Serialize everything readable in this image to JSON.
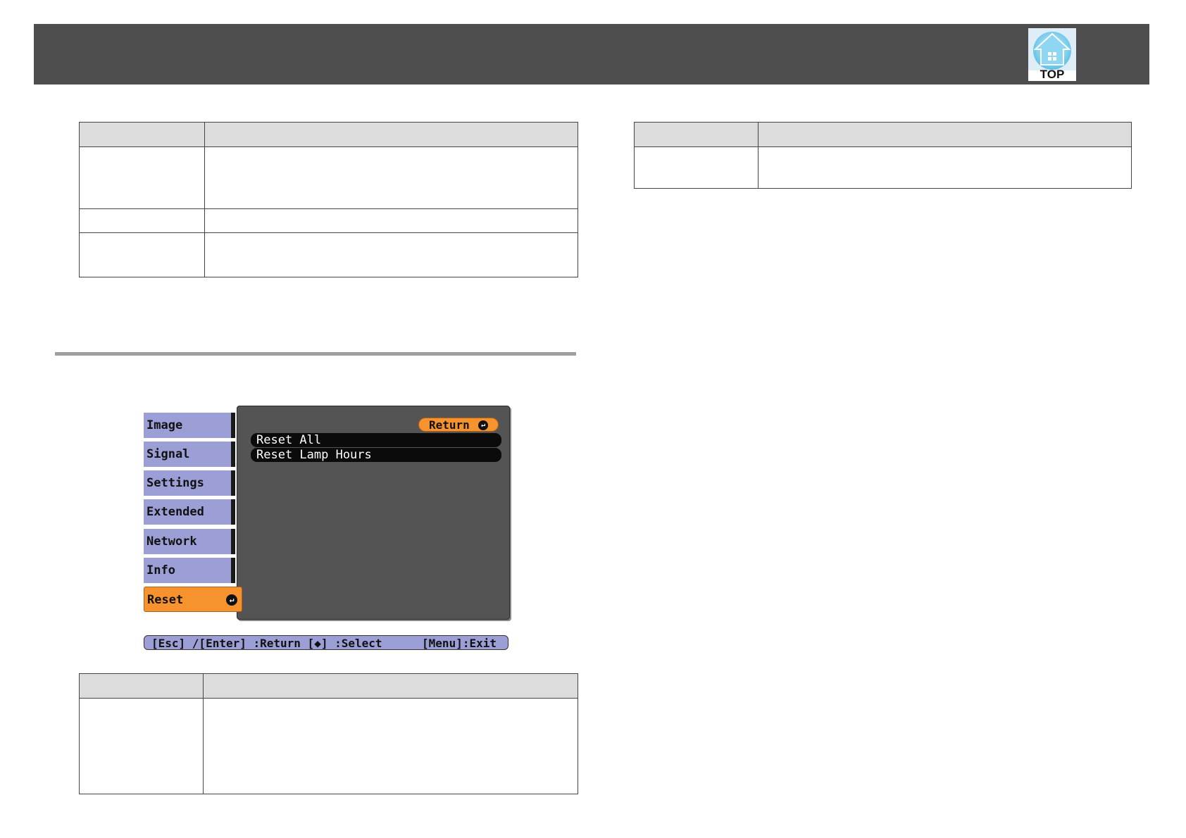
{
  "header": {
    "logo_label": "TOP"
  },
  "osd": {
    "tabs": [
      {
        "label": "Image"
      },
      {
        "label": "Signal"
      },
      {
        "label": "Settings"
      },
      {
        "label": "Extended"
      },
      {
        "label": "Network"
      },
      {
        "label": "Info"
      },
      {
        "label": "Reset"
      }
    ],
    "active_tab": "Reset",
    "return_label": "Return",
    "items": [
      {
        "label": "Reset All"
      },
      {
        "label": "Reset Lamp Hours"
      }
    ],
    "status_left": "[Esc] /[Enter] :Return  [◆] :Select",
    "status_right": "[Menu]:Exit"
  },
  "colors": {
    "header": "#4e4e4e",
    "tab": "#9b9fd6",
    "active": "#f6932f",
    "panel": "#545454"
  },
  "icons": [
    "top-home-icon",
    "enter-icon"
  ]
}
